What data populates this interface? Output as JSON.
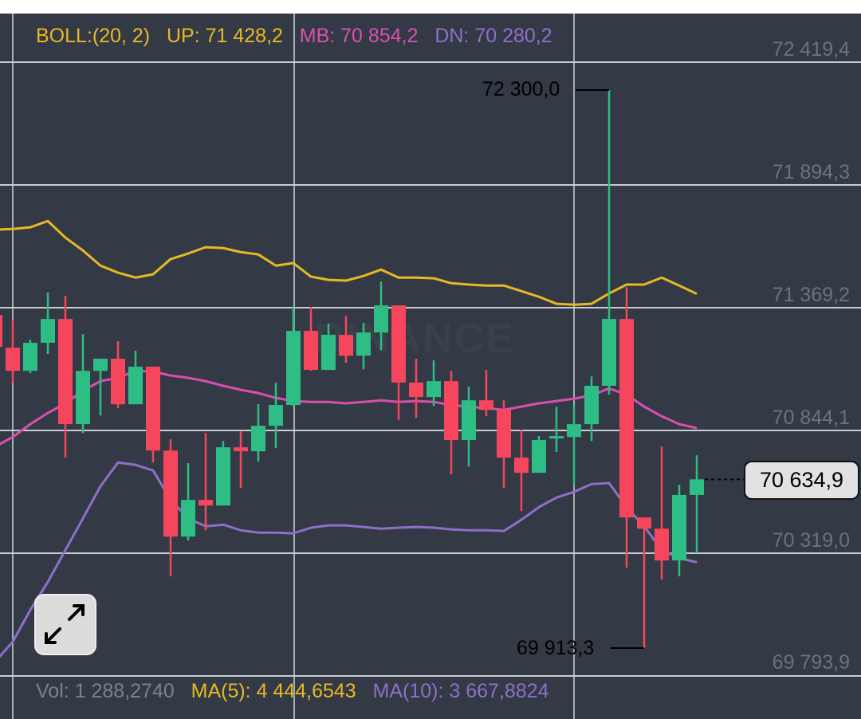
{
  "boll_legend": {
    "label": "BOLL:(20, 2)",
    "up": "UP: 71 428,2",
    "mb": "MB: 70 854,2",
    "dn": "DN: 70 280,2"
  },
  "volume_legend": {
    "vol": "Vol: 1 288,2740",
    "ma5": "MA(5): 4 444,6543",
    "ma10": "MA(10): 3 667,8824"
  },
  "watermark": "BINANCE",
  "current_price": "70 634,9",
  "high_marker": "72 300,0",
  "low_marker": "69 913,3",
  "colors": {
    "bg": "#333a45",
    "up": "#2ebd85",
    "down": "#f6465d",
    "boll_up": "#e8b923",
    "boll_mb": "#d94fb0",
    "boll_dn": "#8e6fc9"
  },
  "chart_data": {
    "type": "candlestick",
    "ylim": [
      69793.9,
      72419.4
    ],
    "y_ticks": [
      "72 419,4",
      "71 894,3",
      "71 369,2",
      "70 844,1",
      "70 319,0",
      "69 793,9"
    ],
    "y_tick_values": [
      72419.4,
      71894.3,
      71369.2,
      70844.1,
      70319.0,
      69793.9
    ],
    "ohlc": [
      [
        71338,
        71355,
        71185,
        71202
      ],
      [
        71198,
        71314,
        71048,
        71099
      ],
      [
        71099,
        71232,
        71089,
        71219
      ],
      [
        71219,
        71434,
        71171,
        71321
      ],
      [
        71321,
        71420,
        70728,
        70871
      ],
      [
        70871,
        71256,
        70833,
        71099
      ],
      [
        71099,
        71151,
        70908,
        71151
      ],
      [
        71151,
        71226,
        70939,
        70956
      ],
      [
        70956,
        71185,
        70956,
        71117
      ],
      [
        71117,
        71117,
        70707,
        70758
      ],
      [
        70758,
        70806,
        70220,
        70390
      ],
      [
        70390,
        70704,
        70373,
        70547
      ],
      [
        70547,
        70833,
        70417,
        70523
      ],
      [
        70523,
        70799,
        70523,
        70772
      ],
      [
        70772,
        70840,
        70598,
        70755
      ],
      [
        70755,
        70956,
        70711,
        70864
      ],
      [
        70864,
        71048,
        70769,
        70953
      ],
      [
        70953,
        71376,
        70946,
        71270
      ],
      [
        71270,
        71372,
        71099,
        71103
      ],
      [
        71103,
        71301,
        71103,
        71253
      ],
      [
        71253,
        71335,
        71133,
        71164
      ],
      [
        71164,
        71304,
        71106,
        71263
      ],
      [
        71263,
        71481,
        71188,
        71379
      ],
      [
        71379,
        71379,
        70888,
        71049
      ],
      [
        71049,
        71151,
        70898,
        70987
      ],
      [
        70987,
        71144,
        70949,
        71055
      ],
      [
        71055,
        71099,
        70656,
        70803
      ],
      [
        70803,
        71031,
        70690,
        70973
      ],
      [
        70973,
        71103,
        70905,
        70932
      ],
      [
        70932,
        70973,
        70598,
        70728
      ],
      [
        70728,
        70847,
        70499,
        70663
      ],
      [
        70663,
        70820,
        70663,
        70803
      ],
      [
        70810,
        70946,
        70752,
        70820
      ],
      [
        70816,
        70949,
        70608,
        70871
      ],
      [
        70871,
        71075,
        70799,
        71035
      ],
      [
        71035,
        72300,
        70997,
        71321
      ],
      [
        71321,
        71457,
        70257,
        70472
      ],
      [
        70472,
        70472,
        69913.3,
        70424
      ],
      [
        70424,
        70775,
        70206,
        70288
      ],
      [
        70288,
        70612,
        70220,
        70568
      ],
      [
        70568,
        70738,
        70319,
        70634.9
      ]
    ],
    "boll_up": [
      71703,
      71706,
      71713,
      71740,
      71669,
      71614,
      71549,
      71519,
      71498,
      71512,
      71577,
      71601,
      71628,
      71624,
      71607,
      71597,
      71549,
      71560,
      71502,
      71488,
      71485,
      71505,
      71532,
      71498,
      71498,
      71495,
      71474,
      71468,
      71464,
      71464,
      71440,
      71416,
      71386,
      71382,
      71386,
      71430,
      71468,
      71468,
      71498,
      71464,
      71428.2
    ],
    "boll_mb": [
      70775,
      70816,
      70871,
      70919,
      70960,
      71014,
      71055,
      71069,
      71099,
      71096,
      71079,
      71069,
      71055,
      71035,
      71018,
      71004,
      70983,
      70970,
      70966,
      70966,
      70960,
      70966,
      70973,
      70966,
      70970,
      70966,
      70953,
      70946,
      70939,
      70932,
      70946,
      70960,
      70970,
      70980,
      70994,
      71024,
      70997,
      70946,
      70905,
      70871,
      70854.2
    ],
    "boll_dn": [
      69855,
      69940,
      70076,
      70196,
      70332,
      70468,
      70605,
      70707,
      70697,
      70673,
      70547,
      70468,
      70434,
      70441,
      70417,
      70407,
      70407,
      70404,
      70428,
      70438,
      70438,
      70431,
      70424,
      70428,
      70431,
      70428,
      70421,
      70417,
      70417,
      70414,
      70462,
      70516,
      70557,
      70581,
      70615,
      70619,
      70516,
      70434,
      70332,
      70298,
      70280.2
    ]
  }
}
